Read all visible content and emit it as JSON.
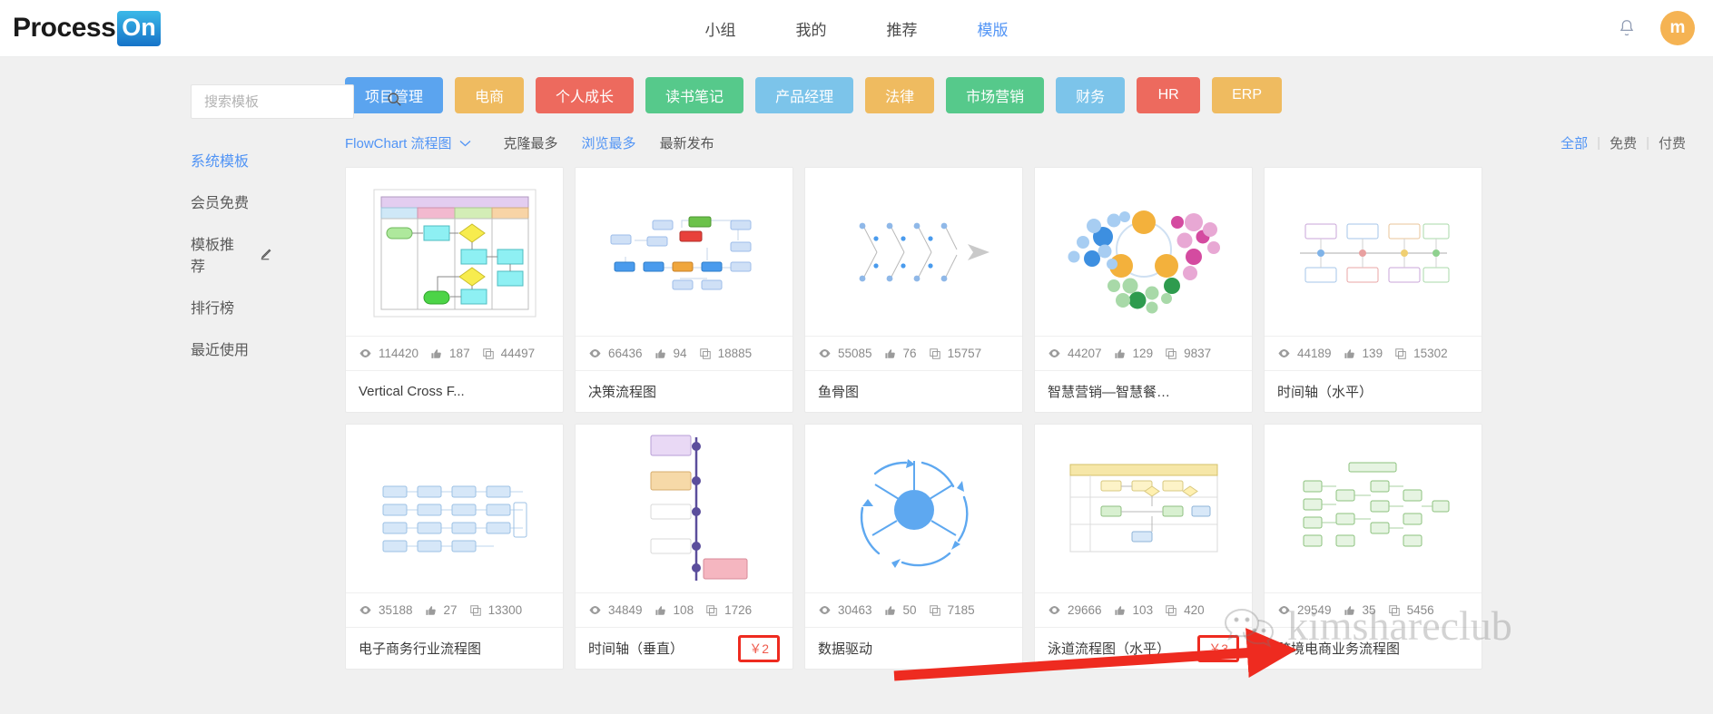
{
  "header": {
    "logo_main": "Process",
    "logo_badge": "On",
    "nav": [
      {
        "label": "小组",
        "active": false
      },
      {
        "label": "我的",
        "active": false
      },
      {
        "label": "推荐",
        "active": false
      },
      {
        "label": "模版",
        "active": true
      }
    ],
    "bell_icon": "bell-icon",
    "avatar_letter": "m",
    "avatar_color": "#f5b353"
  },
  "sidebar": {
    "search": {
      "placeholder": "搜索模板",
      "value": "",
      "icon": "search-icon"
    },
    "items": [
      {
        "label": "系统模板",
        "active": true,
        "icon": null
      },
      {
        "label": "会员免费",
        "active": false,
        "icon": null
      },
      {
        "label": "模板推荐",
        "active": false,
        "icon": "pencil-icon"
      },
      {
        "label": "排行榜",
        "active": false,
        "icon": null
      },
      {
        "label": "最近使用",
        "active": false,
        "icon": null
      }
    ]
  },
  "tags": [
    {
      "label": "项目管理",
      "color": "#5ba4ef"
    },
    {
      "label": "电商",
      "color": "#efbb60"
    },
    {
      "label": "个人成长",
      "color": "#ed6a5e"
    },
    {
      "label": "读书笔记",
      "color": "#56c98b"
    },
    {
      "label": "产品经理",
      "color": "#7cc4ea"
    },
    {
      "label": "法律",
      "color": "#efbb60"
    },
    {
      "label": "市场营销",
      "color": "#56c98b"
    },
    {
      "label": "财务",
      "color": "#7cc4ea"
    },
    {
      "label": "HR",
      "color": "#ed6a5e"
    },
    {
      "label": "ERP",
      "color": "#efbb60"
    }
  ],
  "filters": {
    "category": "FlowChart 流程图",
    "category_icon": "chevron-down-icon",
    "sorts": [
      {
        "label": "克隆最多",
        "active": false
      },
      {
        "label": "浏览最多",
        "active": true
      },
      {
        "label": "最新发布",
        "active": false
      }
    ],
    "price": [
      {
        "label": "全部",
        "active": true
      },
      {
        "label": "免费",
        "active": false
      },
      {
        "label": "付费",
        "active": false
      }
    ]
  },
  "stat_icons": {
    "views": "eye-icon",
    "likes": "thumbs-up-icon",
    "clones": "copy-icon"
  },
  "cards": [
    {
      "title": "Vertical Cross F...",
      "views": "114420",
      "likes": "187",
      "clones": "44497",
      "price": "",
      "highlight": false,
      "thumb": "swimlane-vertical"
    },
    {
      "title": "决策流程图",
      "views": "66436",
      "likes": "94",
      "clones": "18885",
      "price": "",
      "highlight": false,
      "thumb": "decision-flow"
    },
    {
      "title": "鱼骨图",
      "views": "55085",
      "likes": "76",
      "clones": "15757",
      "price": "",
      "highlight": false,
      "thumb": "fishbone"
    },
    {
      "title": "智慧营销—智慧餐…",
      "views": "44207",
      "likes": "129",
      "clones": "9837",
      "price": "",
      "highlight": false,
      "thumb": "bubble-cluster"
    },
    {
      "title": "时间轴（水平）",
      "views": "44189",
      "likes": "139",
      "clones": "15302",
      "price": "",
      "highlight": false,
      "thumb": "timeline-horizontal"
    },
    {
      "title": "电子商务行业流程图",
      "views": "35188",
      "likes": "27",
      "clones": "13300",
      "price": "",
      "highlight": false,
      "thumb": "ecommerce-flow"
    },
    {
      "title": "时间轴（垂直）",
      "views": "34849",
      "likes": "108",
      "clones": "1726",
      "price": "￥2",
      "highlight": true,
      "thumb": "timeline-vertical"
    },
    {
      "title": "数据驱动",
      "views": "30463",
      "likes": "50",
      "clones": "7185",
      "price": "",
      "highlight": false,
      "thumb": "radial-cycle"
    },
    {
      "title": "泳道流程图（水平）",
      "views": "29666",
      "likes": "103",
      "clones": "420",
      "price": "￥3",
      "highlight": true,
      "thumb": "swimlane-horizontal"
    },
    {
      "title": "跨境电商业务流程图",
      "views": "29549",
      "likes": "35",
      "clones": "5456",
      "price": "",
      "highlight": false,
      "thumb": "cross-border-flow"
    }
  ],
  "annotation": {
    "arrow_color": "#ee2b20",
    "watermark_text": "kimshareclub",
    "watermark_icon": "wechat-icon"
  }
}
